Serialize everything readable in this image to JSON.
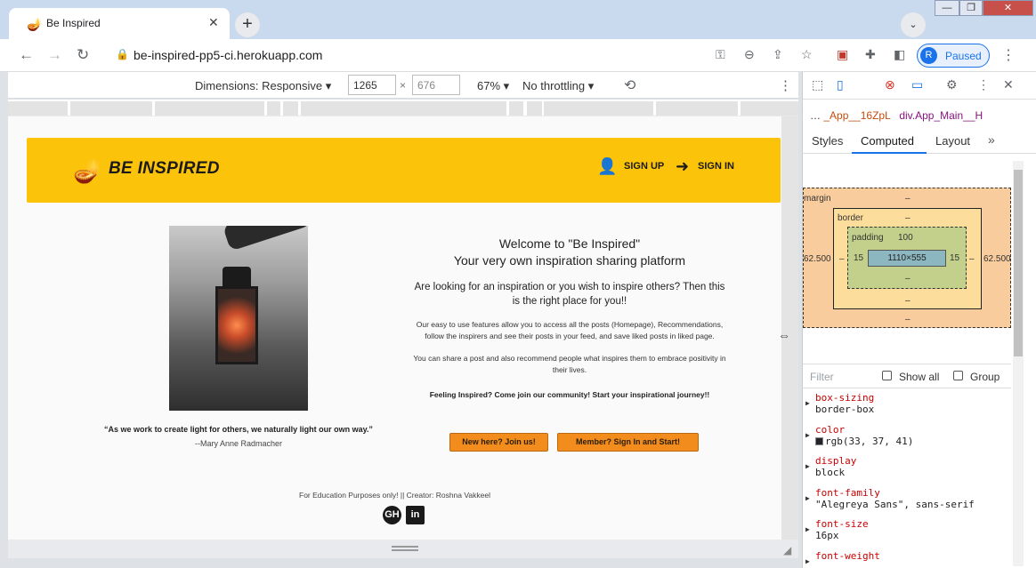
{
  "browser": {
    "tab_title": "Be Inspired",
    "url": "be-inspired-pp5-ci.herokuapp.com",
    "profile_initial": "R",
    "profile_status": "Paused"
  },
  "device_toolbar": {
    "dimensions_label": "Dimensions: Responsive",
    "width": "1265",
    "height": "676",
    "zoom": "67%",
    "throttling": "No throttling"
  },
  "site": {
    "brand": "BE INSPIRED",
    "signup": "SIGN UP",
    "signin": "SIGN IN",
    "quote": "“As we work to create light for others, we naturally light our own way.”",
    "quote_author": "--Mary Anne Radmacher",
    "welcome_line1": "Welcome to \"Be Inspired\"",
    "welcome_line2": "Your very own inspiration sharing platform",
    "lead": "Are looking for an inspiration or you wish to inspire others? Then this is the right place for you!!",
    "features": "Our easy to use features allow you to access all the posts (Homepage), Recommendations, follow the inspirers and see their posts in your feed, and save liked posts in liked page.",
    "share": "You can share a post and also recommend people what inspires them to embrace positivity in their lives.",
    "cta": "Feeling Inspired? Come join our community! Start your inspirational journey!!",
    "btn_new": "New here? Join us!",
    "btn_member": "Member? Sign In and Start!",
    "footer": "For Education Purposes only! || Creator: Roshna Vakkeel",
    "github": "GH",
    "linkedin": "in"
  },
  "devtools": {
    "breadcrumb_1": "_App__16ZpL",
    "breadcrumb_2": "div.App_Main__H",
    "tabs": [
      "Styles",
      "Computed",
      "Layout"
    ],
    "active_tab": "Computed",
    "box_model": {
      "margin_label": "margin",
      "margin_top": "–",
      "margin_left": "62.500",
      "margin_right": "62.500",
      "margin_bottom": "–",
      "border_label": "border",
      "border_top": "–",
      "border_left": "–",
      "border_right": "–",
      "border_bottom": "–",
      "padding_label": "padding",
      "padding_top": "100",
      "padding_left": "15",
      "padding_right": "15",
      "padding_bottom": "–",
      "content": "1110×555"
    },
    "filter_placeholder": "Filter",
    "show_all": "Show all",
    "group": "Group",
    "properties": [
      {
        "name": "box-sizing",
        "value": "border-box"
      },
      {
        "name": "color",
        "value": "rgb(33, 37, 41)"
      },
      {
        "name": "display",
        "value": "block"
      },
      {
        "name": "font-family",
        "value": "\"Alegreya Sans\", sans-serif"
      },
      {
        "name": "font-size",
        "value": "16px"
      },
      {
        "name": "font-weight",
        "value": ""
      }
    ]
  },
  "colors": {
    "header_yellow": "#fcc30b",
    "button_orange": "#f28c1c",
    "chrome_blue": "#1a73e8"
  }
}
